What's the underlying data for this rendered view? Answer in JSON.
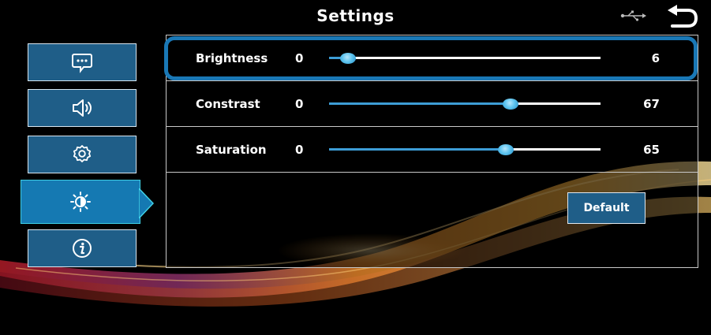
{
  "header": {
    "title": "Settings",
    "icons": {
      "usb": "usb-icon",
      "back": "back-arrow-icon"
    }
  },
  "sidebar": {
    "items": [
      {
        "name": "messages",
        "icon": "chat-bubble-icon",
        "active": false
      },
      {
        "name": "sound",
        "icon": "speaker-icon",
        "active": false
      },
      {
        "name": "general",
        "icon": "gear-icon",
        "active": false
      },
      {
        "name": "display",
        "icon": "brightness-icon",
        "active": true
      },
      {
        "name": "about",
        "icon": "info-icon",
        "active": false
      }
    ]
  },
  "settings": {
    "rows": [
      {
        "label": "Brightness",
        "min": "0",
        "value": "6",
        "fraction": 0.07,
        "selected": true
      },
      {
        "label": "Constrast",
        "min": "0",
        "value": "67",
        "fraction": 0.67,
        "selected": false
      },
      {
        "label": "Saturation",
        "min": "0",
        "value": "65",
        "fraction": 0.65,
        "selected": false
      }
    ],
    "default_label": "Default"
  },
  "colors": {
    "accent": "#1579b2",
    "highlight_border": "#1a78b6",
    "slider_fill": "#3d9dd6",
    "active_outline": "#3fd0e6"
  }
}
